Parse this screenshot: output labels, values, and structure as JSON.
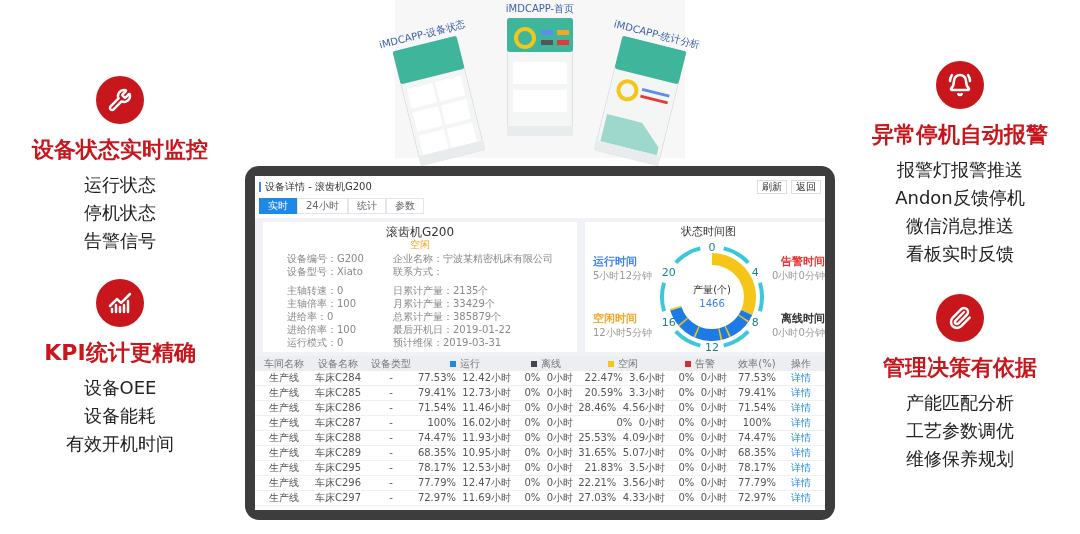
{
  "phones": [
    {
      "title": "iMDCAPP-设备状态"
    },
    {
      "title": "iMDCAPP-首页"
    },
    {
      "title": "iMDCAPP-统计分析"
    }
  ],
  "features_left": [
    {
      "heading": "设备状态实时监控",
      "items": [
        "运行状态",
        "停机状态",
        "告警信号"
      ]
    },
    {
      "heading": "KPI统计更精确",
      "items": [
        "设备OEE",
        "设备能耗",
        "有效开机时间"
      ]
    }
  ],
  "features_right": [
    {
      "heading": "异常停机自动报警",
      "items": [
        "报警灯报警推送",
        "Andon反馈停机",
        "微信消息推送",
        "看板实时反馈"
      ]
    },
    {
      "heading": "管理决策有依据",
      "items": [
        "产能匹配分析",
        "工艺参数调优",
        "维修保养规划"
      ]
    }
  ],
  "screen": {
    "title": "设备详情 - 滚齿机G200",
    "buttons": [
      "刷新",
      "返回"
    ],
    "tabs": [
      {
        "label": "实时",
        "selected": true
      },
      {
        "label": "24小时",
        "selected": false
      },
      {
        "label": "统计",
        "selected": false
      },
      {
        "label": "参数",
        "selected": false
      }
    ],
    "info": {
      "name": "滚齿机G200",
      "status": "空闲",
      "left": [
        [
          "设备编号：G200",
          "设备型号：Xiato"
        ],
        [
          "主轴转速：0",
          "主轴倍率：100",
          "进给率：0",
          "进给倍率：100",
          "运行模式：0"
        ]
      ],
      "right": [
        [
          "企业名称：宁波某精密机床有限公司",
          "联系方式："
        ],
        [
          "日累计产量：2135个",
          "月累计产量：33429个",
          "总累计产量：385879个",
          "最后开机日：2019-01-22",
          "预计维保：2019-03-31"
        ]
      ]
    },
    "status_chart": {
      "title": "状态时间图",
      "hour_labels": [
        "0",
        "4",
        "8",
        "12",
        "16",
        "20"
      ],
      "center_label": "产量(个)",
      "center_value": "1466",
      "legend": [
        {
          "label": "运行时间",
          "value": "5小时12分钟",
          "color": "#3b82f6"
        },
        {
          "label": "告警时间",
          "value": "0小时0分钟",
          "color": "#e53935"
        },
        {
          "label": "空闲时间",
          "value": "12小时5分钟",
          "color": "#f5a623"
        },
        {
          "label": "离线时间",
          "value": "0小时0分钟",
          "color": "#333333"
        }
      ]
    },
    "table": {
      "columns": [
        {
          "label": "车间名称"
        },
        {
          "label": "设备名称"
        },
        {
          "label": "设备类型"
        },
        {
          "label": "运行",
          "color": "#1e88e5"
        },
        {
          "label": "离线",
          "color": "#444455"
        },
        {
          "label": "空闲",
          "color": "#f5c518"
        },
        {
          "label": "告警",
          "color": "#d32f2f"
        },
        {
          "label": "效率(%)"
        },
        {
          "label": "操作"
        }
      ],
      "rows": [
        [
          "生产线",
          "车床C284",
          "-",
          "77.53%  12.42小时",
          "0%  0小时",
          "22.47%  3.6小时",
          "0%  0小时",
          "77.53%",
          "详情"
        ],
        [
          "生产线",
          "车床C285",
          "-",
          "79.41%  12.73小时",
          "0%  0小时",
          "20.59%  3.3小时",
          "0%  0小时",
          "79.41%",
          "详情"
        ],
        [
          "生产线",
          "车床C286",
          "-",
          "71.54%  11.46小时",
          "0%  0小时",
          "28.46%  4.56小时",
          "0%  0小时",
          "71.54%",
          "详情"
        ],
        [
          "生产线",
          "车床C287",
          "-",
          "100%  16.02小时",
          "0%  0小时",
          "0%  0小时",
          "0%  0小时",
          "100%",
          "详情"
        ],
        [
          "生产线",
          "车床C288",
          "-",
          "74.47%  11.93小时",
          "0%  0小时",
          "25.53%  4.09小时",
          "0%  0小时",
          "74.47%",
          "详情"
        ],
        [
          "生产线",
          "车床C289",
          "-",
          "68.35%  10.95小时",
          "0%  0小时",
          "31.65%  5.07小时",
          "0%  0小时",
          "68.35%",
          "详情"
        ],
        [
          "生产线",
          "车床C295",
          "-",
          "78.17%  12.53小时",
          "0%  0小时",
          "21.83%  3.5小时",
          "0%  0小时",
          "78.17%",
          "详情"
        ],
        [
          "生产线",
          "车床C296",
          "-",
          "77.79%  12.47小时",
          "0%  0小时",
          "22.21%  3.56小时",
          "0%  0小时",
          "77.79%",
          "详情"
        ],
        [
          "生产线",
          "车床C297",
          "-",
          "72.97%  11.69小时",
          "0%  0小时",
          "27.03%  4.33小时",
          "0%  0小时",
          "72.97%",
          "详情"
        ]
      ]
    }
  }
}
